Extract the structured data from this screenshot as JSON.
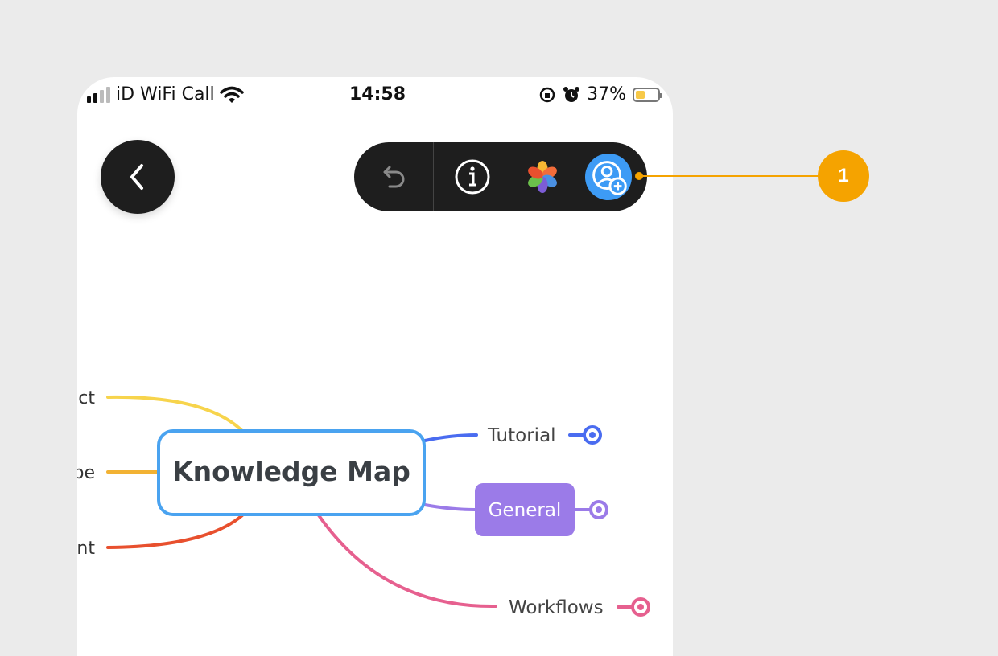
{
  "status_bar": {
    "carrier": "iD WiFi Call",
    "time": "14:58",
    "battery": "37%",
    "battery_level": 0.37
  },
  "toolbar": {
    "back_icon": "chevron-left-icon",
    "undo_icon": "undo-icon",
    "info_icon": "info-icon",
    "theme_icon": "color-flower-icon",
    "share_icon": "add-collaborator-icon"
  },
  "mind_map": {
    "central_topic": "Knowledge Map",
    "left_branches": [
      {
        "label": "ct",
        "color": "#f7d44c"
      },
      {
        "label": "pe",
        "color": "#f2b233"
      },
      {
        "label": "nt",
        "color": "#e8502e"
      }
    ],
    "right_branches": [
      {
        "label": "Tutorial",
        "color": "#4a6cf0"
      },
      {
        "label": "General",
        "color": "#9b7be8"
      },
      {
        "label": "Workflows",
        "color": "#e6608f"
      }
    ]
  },
  "callout": {
    "number": "1",
    "color": "#f5a300"
  }
}
